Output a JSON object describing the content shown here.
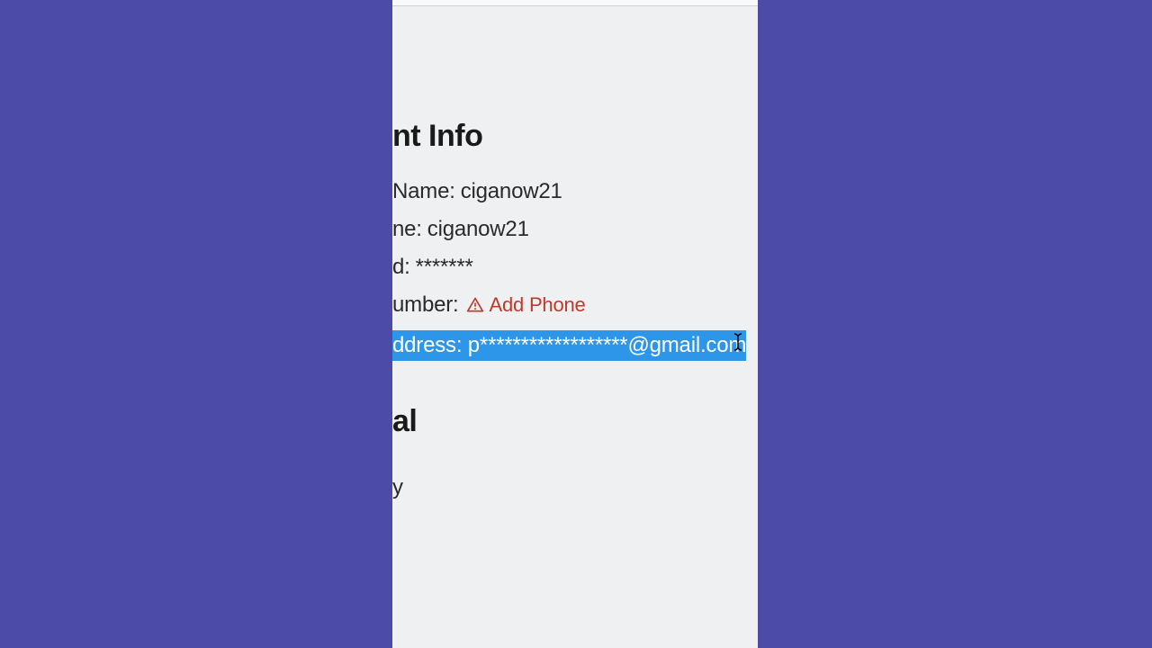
{
  "account": {
    "section_heading": "nt Info",
    "display_name_label": "Name:",
    "display_name_value": "ciganow21",
    "username_label": "ne:",
    "username_value": "ciganow21",
    "password_label": "d:",
    "password_value": "*******",
    "phone_label": "umber:",
    "add_phone_label": "Add Phone",
    "email_label": "ddress:",
    "email_value": "p******************@gmail.com"
  },
  "personal": {
    "section_heading": "al",
    "birthday_label": "y"
  },
  "colors": {
    "background": "#4c4ba8",
    "panel": "#eef0f2",
    "highlight": "#2e96e8",
    "warning": "#c0392b"
  }
}
